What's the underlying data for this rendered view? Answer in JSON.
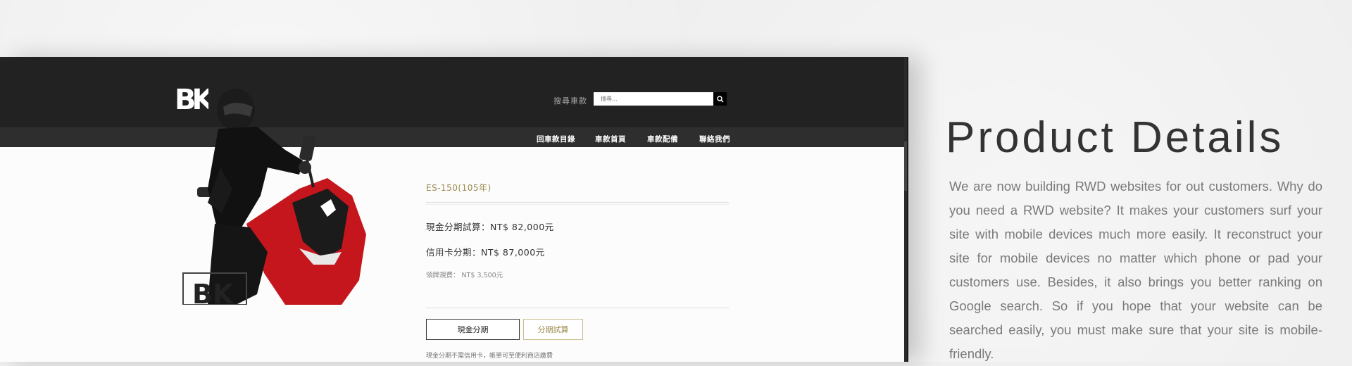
{
  "site": {
    "logo_text": "BK",
    "search_label": "搜尋車款",
    "search_placeholder": "搜尋...",
    "nav": [
      "回車款目錄",
      "車款首頁",
      "車款配備",
      "聯絡我們"
    ]
  },
  "product": {
    "title": "ES-150(105年)",
    "cash_price": "現金分期試算：NT$ 82,000元",
    "credit_price": "信用卡分期：NT$ 87,000元",
    "fee": "領牌規費： NT$ 3,500元",
    "cash_button": "現金分期",
    "calc_button": "分期試算",
    "note": "現金分期不需信用卡，帳單可至便利商店繳費"
  },
  "panel": {
    "heading": "Product Details",
    "description": "We are now building RWD websites for out customers. Why do you need a RWD website? It makes your customers surf your site with mobile devices much more easily. It reconstruct your site for mobile devices no matter which phone or pad your customers use. Besides, it also brings you better ranking on Google search. So if you hope that your website can be searched easily, you must make sure that your site is mobile-friendly."
  },
  "colors": {
    "header_bg": "#222222",
    "nav_bg": "#2e2e2e",
    "accent_gold": "#9c8a4e",
    "scooter_red": "#c4161c"
  }
}
